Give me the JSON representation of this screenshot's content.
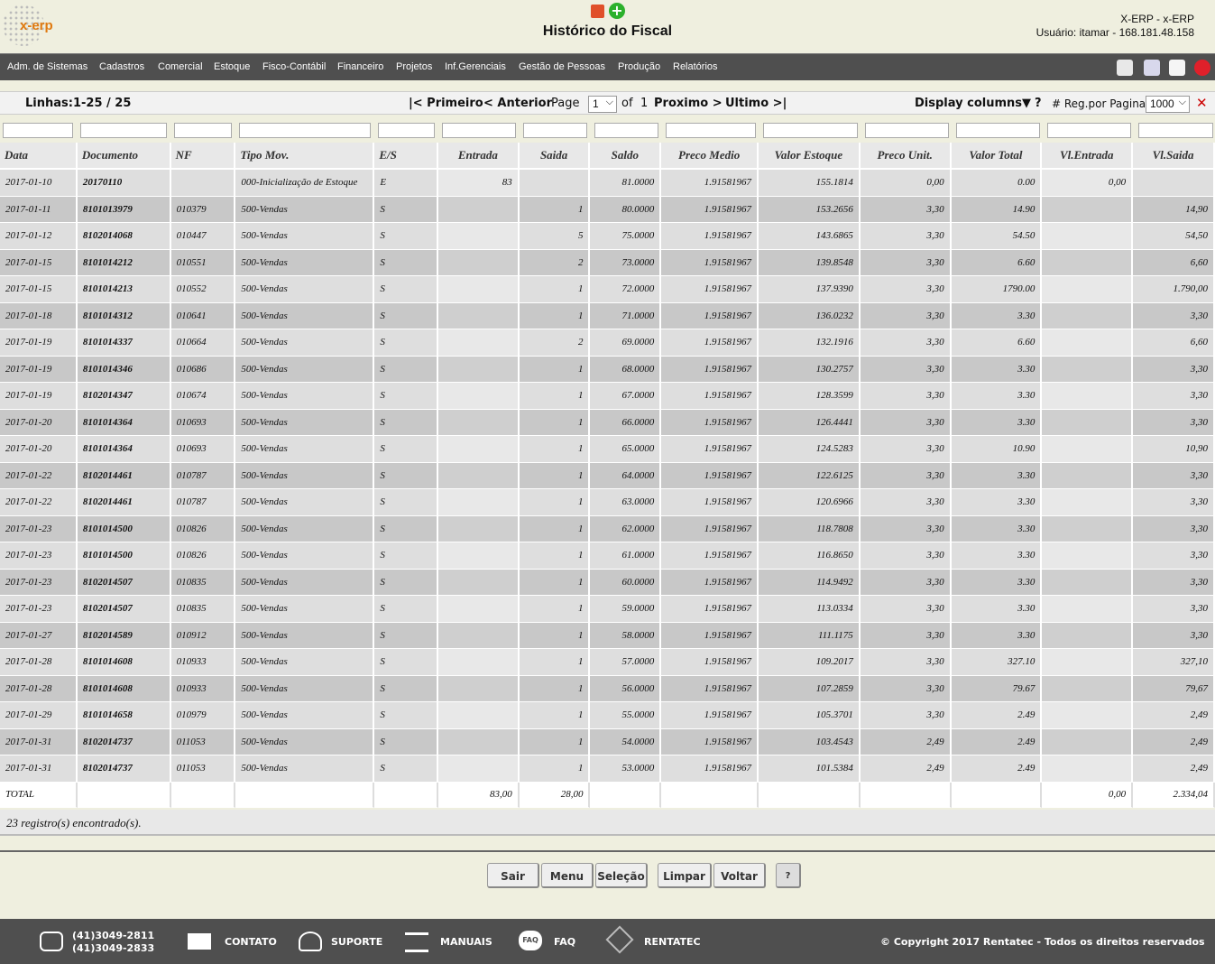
{
  "header": {
    "logo_text": "x-erp",
    "title": "Histórico do Fiscal",
    "company": "X-ERP - x-ERP",
    "user": "Usuário: itamar - 168.181.48.158"
  },
  "menu": [
    "Adm. de Sistemas",
    "Cadastros",
    "Comercial",
    "Estoque",
    "Fisco-Contábil",
    "Financeiro",
    "Projetos",
    "Inf.Gerenciais",
    "Gestão de Pessoas",
    "Produção",
    "Relatórios"
  ],
  "toolbar": {
    "lines": "Linhas:1-25 / 25",
    "first": "|< Primeiro",
    "prev": "< Anterior",
    "page_label": "Page",
    "page_value": "1",
    "of": "of",
    "total_pages": "1",
    "next": "Proximo >",
    "last": "Ultimo >|",
    "display_columns": "Display columns▼",
    "help": "?",
    "reg_label": "# Reg.por Pagina",
    "reg_value": "1000"
  },
  "columns": [
    "Data",
    "Documento",
    "NF",
    "Tipo Mov.",
    "E/S",
    "Entrada",
    "Saida",
    "Saldo",
    "Preco Medio",
    "Valor Estoque",
    "Preco Unit.",
    "Valor Total",
    "Vl.Entrada",
    "Vl.Saida"
  ],
  "rows": [
    [
      "2017-01-10",
      "20170110",
      "",
      "000-Inicialização de Estoque",
      "E",
      "83",
      "",
      "81.0000",
      "1.91581967",
      "155.1814",
      "0,00",
      "0.00",
      "0,00",
      ""
    ],
    [
      "2017-01-11",
      "8101013979",
      "010379",
      "500-Vendas",
      "S",
      "",
      "1",
      "80.0000",
      "1.91581967",
      "153.2656",
      "3,30",
      "14.90",
      "",
      "14,90"
    ],
    [
      "2017-01-12",
      "8102014068",
      "010447",
      "500-Vendas",
      "S",
      "",
      "5",
      "75.0000",
      "1.91581967",
      "143.6865",
      "3,30",
      "54.50",
      "",
      "54,50"
    ],
    [
      "2017-01-15",
      "8101014212",
      "010551",
      "500-Vendas",
      "S",
      "",
      "2",
      "73.0000",
      "1.91581967",
      "139.8548",
      "3,30",
      "6.60",
      "",
      "6,60"
    ],
    [
      "2017-01-15",
      "8101014213",
      "010552",
      "500-Vendas",
      "S",
      "",
      "1",
      "72.0000",
      "1.91581967",
      "137.9390",
      "3,30",
      "1790.00",
      "",
      "1.790,00"
    ],
    [
      "2017-01-18",
      "8101014312",
      "010641",
      "500-Vendas",
      "S",
      "",
      "1",
      "71.0000",
      "1.91581967",
      "136.0232",
      "3,30",
      "3.30",
      "",
      "3,30"
    ],
    [
      "2017-01-19",
      "8101014337",
      "010664",
      "500-Vendas",
      "S",
      "",
      "2",
      "69.0000",
      "1.91581967",
      "132.1916",
      "3,30",
      "6.60",
      "",
      "6,60"
    ],
    [
      "2017-01-19",
      "8101014346",
      "010686",
      "500-Vendas",
      "S",
      "",
      "1",
      "68.0000",
      "1.91581967",
      "130.2757",
      "3,30",
      "3.30",
      "",
      "3,30"
    ],
    [
      "2017-01-19",
      "8102014347",
      "010674",
      "500-Vendas",
      "S",
      "",
      "1",
      "67.0000",
      "1.91581967",
      "128.3599",
      "3,30",
      "3.30",
      "",
      "3,30"
    ],
    [
      "2017-01-20",
      "8101014364",
      "010693",
      "500-Vendas",
      "S",
      "",
      "1",
      "66.0000",
      "1.91581967",
      "126.4441",
      "3,30",
      "3.30",
      "",
      "3,30"
    ],
    [
      "2017-01-20",
      "8101014364",
      "010693",
      "500-Vendas",
      "S",
      "",
      "1",
      "65.0000",
      "1.91581967",
      "124.5283",
      "3,30",
      "10.90",
      "",
      "10,90"
    ],
    [
      "2017-01-22",
      "8102014461",
      "010787",
      "500-Vendas",
      "S",
      "",
      "1",
      "64.0000",
      "1.91581967",
      "122.6125",
      "3,30",
      "3.30",
      "",
      "3,30"
    ],
    [
      "2017-01-22",
      "8102014461",
      "010787",
      "500-Vendas",
      "S",
      "",
      "1",
      "63.0000",
      "1.91581967",
      "120.6966",
      "3,30",
      "3.30",
      "",
      "3,30"
    ],
    [
      "2017-01-23",
      "8101014500",
      "010826",
      "500-Vendas",
      "S",
      "",
      "1",
      "62.0000",
      "1.91581967",
      "118.7808",
      "3,30",
      "3.30",
      "",
      "3,30"
    ],
    [
      "2017-01-23",
      "8101014500",
      "010826",
      "500-Vendas",
      "S",
      "",
      "1",
      "61.0000",
      "1.91581967",
      "116.8650",
      "3,30",
      "3.30",
      "",
      "3,30"
    ],
    [
      "2017-01-23",
      "8102014507",
      "010835",
      "500-Vendas",
      "S",
      "",
      "1",
      "60.0000",
      "1.91581967",
      "114.9492",
      "3,30",
      "3.30",
      "",
      "3,30"
    ],
    [
      "2017-01-23",
      "8102014507",
      "010835",
      "500-Vendas",
      "S",
      "",
      "1",
      "59.0000",
      "1.91581967",
      "113.0334",
      "3,30",
      "3.30",
      "",
      "3,30"
    ],
    [
      "2017-01-27",
      "8102014589",
      "010912",
      "500-Vendas",
      "S",
      "",
      "1",
      "58.0000",
      "1.91581967",
      "111.1175",
      "3,30",
      "3.30",
      "",
      "3,30"
    ],
    [
      "2017-01-28",
      "8101014608",
      "010933",
      "500-Vendas",
      "S",
      "",
      "1",
      "57.0000",
      "1.91581967",
      "109.2017",
      "3,30",
      "327.10",
      "",
      "327,10"
    ],
    [
      "2017-01-28",
      "8101014608",
      "010933",
      "500-Vendas",
      "S",
      "",
      "1",
      "56.0000",
      "1.91581967",
      "107.2859",
      "3,30",
      "79.67",
      "",
      "79,67"
    ],
    [
      "2017-01-29",
      "8101014658",
      "010979",
      "500-Vendas",
      "S",
      "",
      "1",
      "55.0000",
      "1.91581967",
      "105.3701",
      "3,30",
      "2.49",
      "",
      "2,49"
    ],
    [
      "2017-01-31",
      "8102014737",
      "011053",
      "500-Vendas",
      "S",
      "",
      "1",
      "54.0000",
      "1.91581967",
      "103.4543",
      "2,49",
      "2.49",
      "",
      "2,49"
    ],
    [
      "2017-01-31",
      "8102014737",
      "011053",
      "500-Vendas",
      "S",
      "",
      "1",
      "53.0000",
      "1.91581967",
      "101.5384",
      "2,49",
      "2.49",
      "",
      "2,49"
    ]
  ],
  "totals": [
    "TOTAL",
    "",
    "",
    "",
    "",
    "83,00",
    "28,00",
    "",
    "",
    "",
    "",
    "",
    "0,00",
    "2.334,04"
  ],
  "found": "23 registro(s) encontrado(s).",
  "buttons": {
    "sair": "Sair",
    "menu": "Menu",
    "selecao": "Seleção",
    "limpar": "Limpar",
    "voltar": "Voltar",
    "help": "?"
  },
  "footer": {
    "phone1": "(41)3049-2811",
    "phone2": "(41)3049-2833",
    "contato": "CONTATO",
    "suporte": "SUPORTE",
    "manuais": "MANUAIS",
    "faq": "FAQ",
    "faq_icon": "FAQ",
    "rentatec": "RENTATEC",
    "copyright": "© Copyright 2017 Rentatec - Todos os direitos reservados"
  },
  "icons": {
    "home": "home-icon",
    "export": "export-icon",
    "print": "print-icon",
    "logout": "power-icon",
    "pdf": "pdf-icon",
    "add": "add-icon"
  }
}
